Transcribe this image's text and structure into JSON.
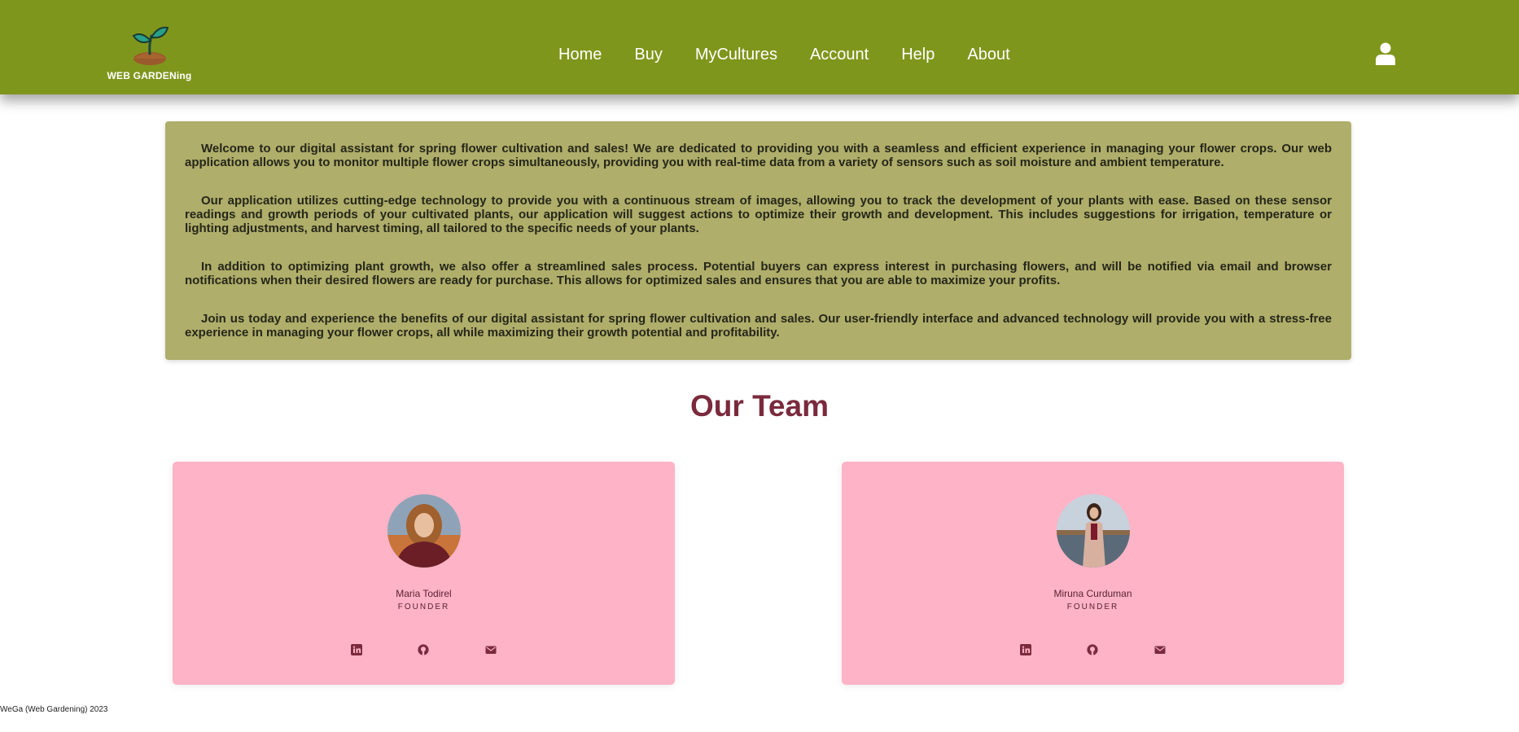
{
  "brand": {
    "name": "WEB GARDENing",
    "color": "#7f961c"
  },
  "nav": {
    "items": [
      "Home",
      "Buy",
      "MyCultures",
      "Account",
      "Help",
      "About"
    ]
  },
  "header": {
    "account_icon": "user-icon"
  },
  "intro": {
    "paragraphs": [
      "Welcome to our digital assistant for spring flower cultivation and sales! We are dedicated to providing you with a seamless and efficient experience in managing your flower crops. Our web application allows you to monitor multiple flower crops simultaneously, providing you with real-time data from a variety of sensors such as soil moisture and ambient temperature.",
      "Our application utilizes cutting-edge technology to provide you with a continuous stream of images, allowing you to track the development of your plants with ease. Based on these sensor readings and growth periods of your cultivated plants, our application will suggest actions to optimize their growth and development. This includes suggestions for irrigation, temperature or lighting adjustments, and harvest timing, all tailored to the specific needs of your plants.",
      "In addition to optimizing plant growth, we also offer a streamlined sales process. Potential buyers can express interest in purchasing flowers, and will be notified via email and browser notifications when their desired flowers are ready for purchase. This allows for optimized sales and ensures that you are able to maximize your profits.",
      "Join us today and experience the benefits of our digital assistant for spring flower cultivation and sales. Our user-friendly interface and advanced technology will provide you with a stress-free experience in managing your flower crops, all while maximizing their growth potential and profitability."
    ]
  },
  "team": {
    "title": "Our Team",
    "members": [
      {
        "name": "Maria Todirel",
        "role": "FOUNDER",
        "socials": [
          "linkedin-icon",
          "github-icon",
          "envelope-icon"
        ]
      },
      {
        "name": "Miruna Curduman",
        "role": "FOUNDER",
        "socials": [
          "linkedin-icon",
          "github-icon",
          "envelope-icon"
        ]
      }
    ]
  },
  "footer": {
    "text": "WeGa (Web Gardening) 2023"
  },
  "colors": {
    "header": "#7f961c",
    "intro_bg": "#afae6a",
    "card_bg": "#feb3c7",
    "title": "#7a2a3c"
  }
}
